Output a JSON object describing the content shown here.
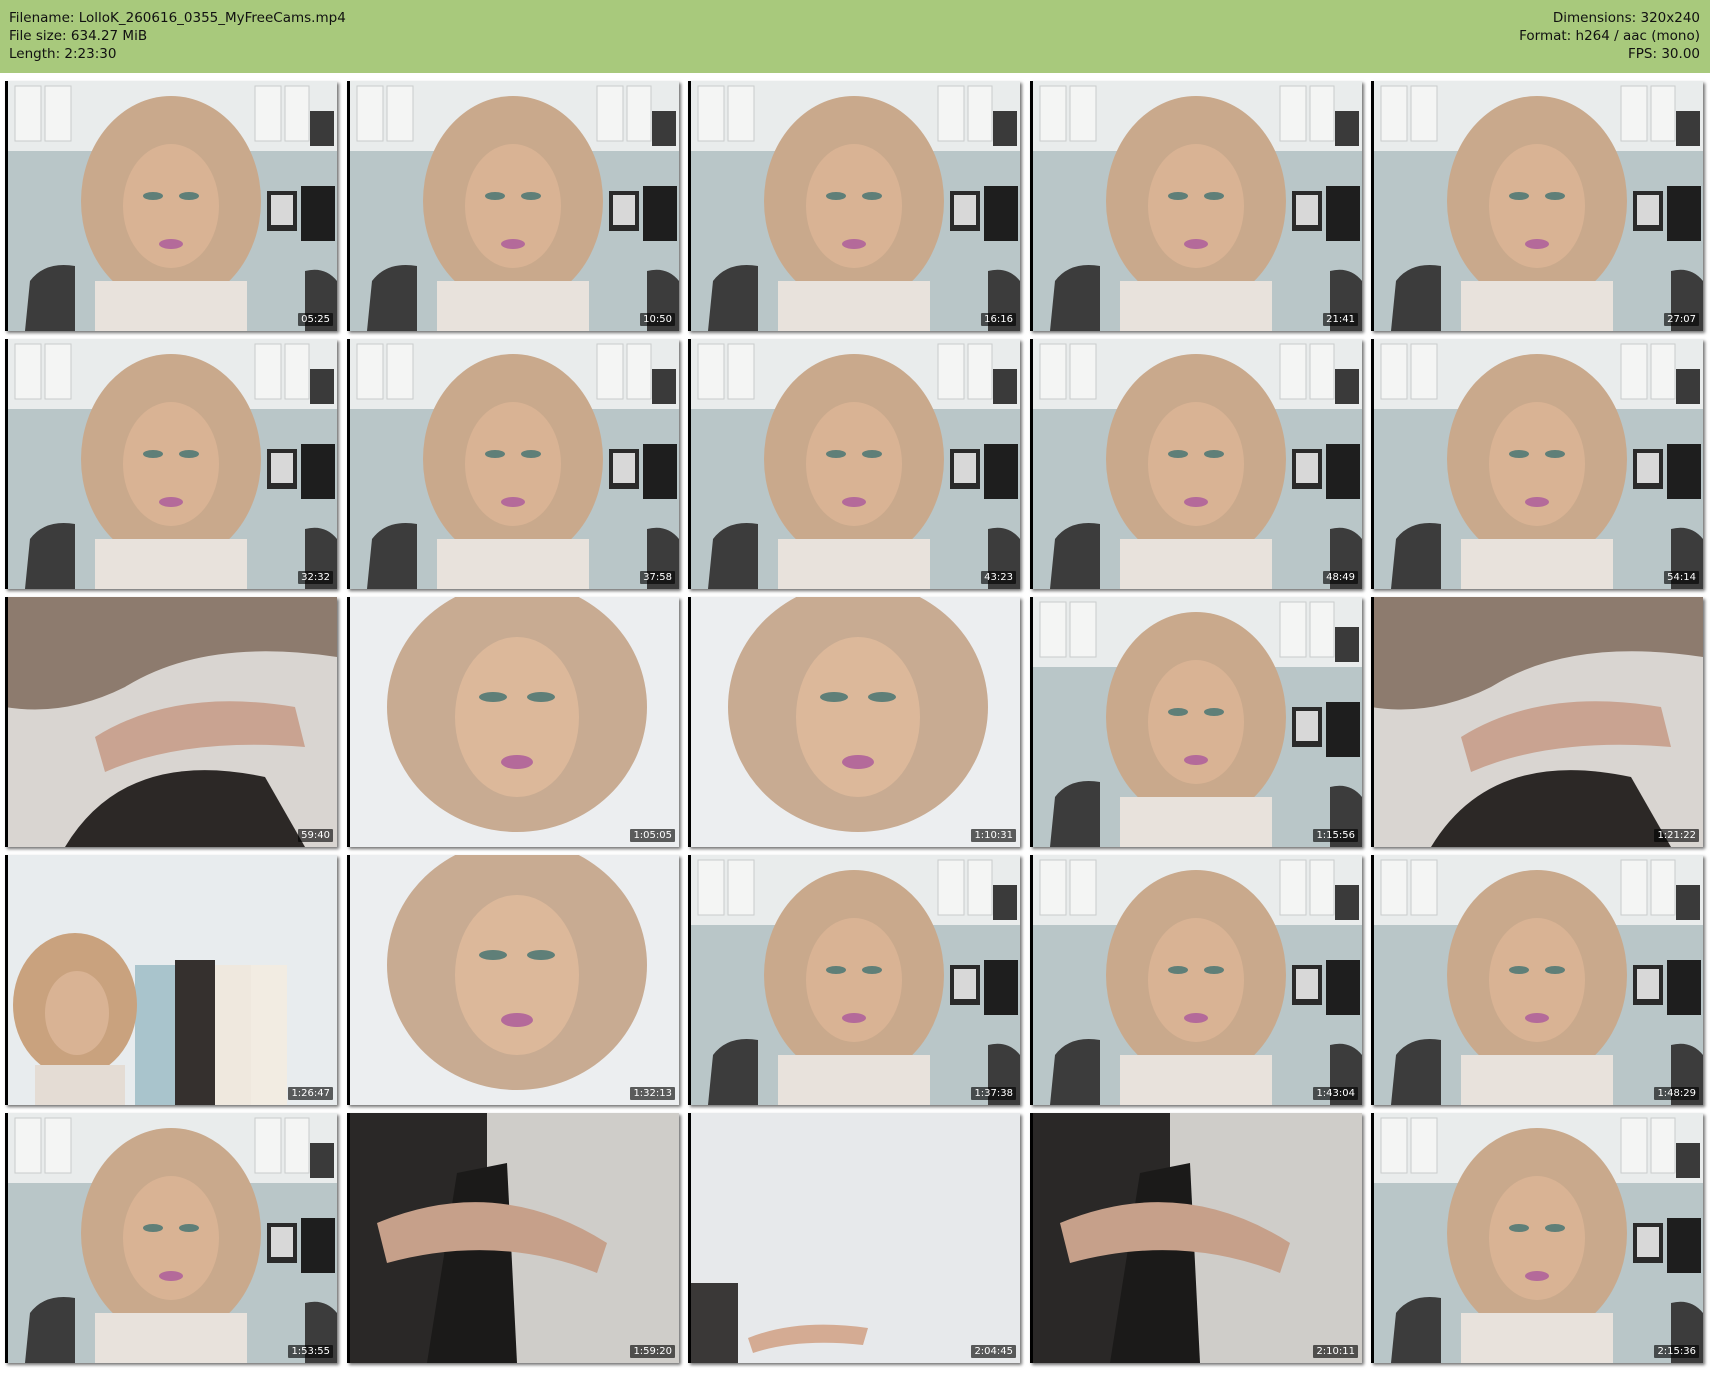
{
  "header": {
    "filename_label": "Filename: LolloK_260616_0355_MyFreeCams.mp4",
    "filesize_label": "File size: 634.27 MiB",
    "length_label": "Length: 2:23:30",
    "dimensions_label": "Dimensions: 320x240",
    "format_label": "Format: h264 / aac (mono)",
    "fps_label": "FPS: 30.00",
    "bg_color": "#a8c97c"
  },
  "thumbnails": [
    {
      "timestamp": "05:25",
      "scene": "office"
    },
    {
      "timestamp": "10:50",
      "scene": "office"
    },
    {
      "timestamp": "16:16",
      "scene": "office"
    },
    {
      "timestamp": "21:41",
      "scene": "office"
    },
    {
      "timestamp": "27:07",
      "scene": "office"
    },
    {
      "timestamp": "32:32",
      "scene": "office"
    },
    {
      "timestamp": "37:58",
      "scene": "office"
    },
    {
      "timestamp": "43:23",
      "scene": "office"
    },
    {
      "timestamp": "48:49",
      "scene": "office"
    },
    {
      "timestamp": "54:14",
      "scene": "office"
    },
    {
      "timestamp": "59:40",
      "scene": "closeup"
    },
    {
      "timestamp": "1:05:05",
      "scene": "bright"
    },
    {
      "timestamp": "1:10:31",
      "scene": "bright"
    },
    {
      "timestamp": "1:15:56",
      "scene": "office"
    },
    {
      "timestamp": "1:21:22",
      "scene": "closeup"
    },
    {
      "timestamp": "1:26:47",
      "scene": "shelf"
    },
    {
      "timestamp": "1:32:13",
      "scene": "bright"
    },
    {
      "timestamp": "1:37:38",
      "scene": "office"
    },
    {
      "timestamp": "1:43:04",
      "scene": "office"
    },
    {
      "timestamp": "1:48:29",
      "scene": "office"
    },
    {
      "timestamp": "1:53:55",
      "scene": "office"
    },
    {
      "timestamp": "1:59:20",
      "scene": "dark"
    },
    {
      "timestamp": "2:04:45",
      "scene": "wall"
    },
    {
      "timestamp": "2:10:11",
      "scene": "dark"
    },
    {
      "timestamp": "2:15:36",
      "scene": "office"
    }
  ]
}
